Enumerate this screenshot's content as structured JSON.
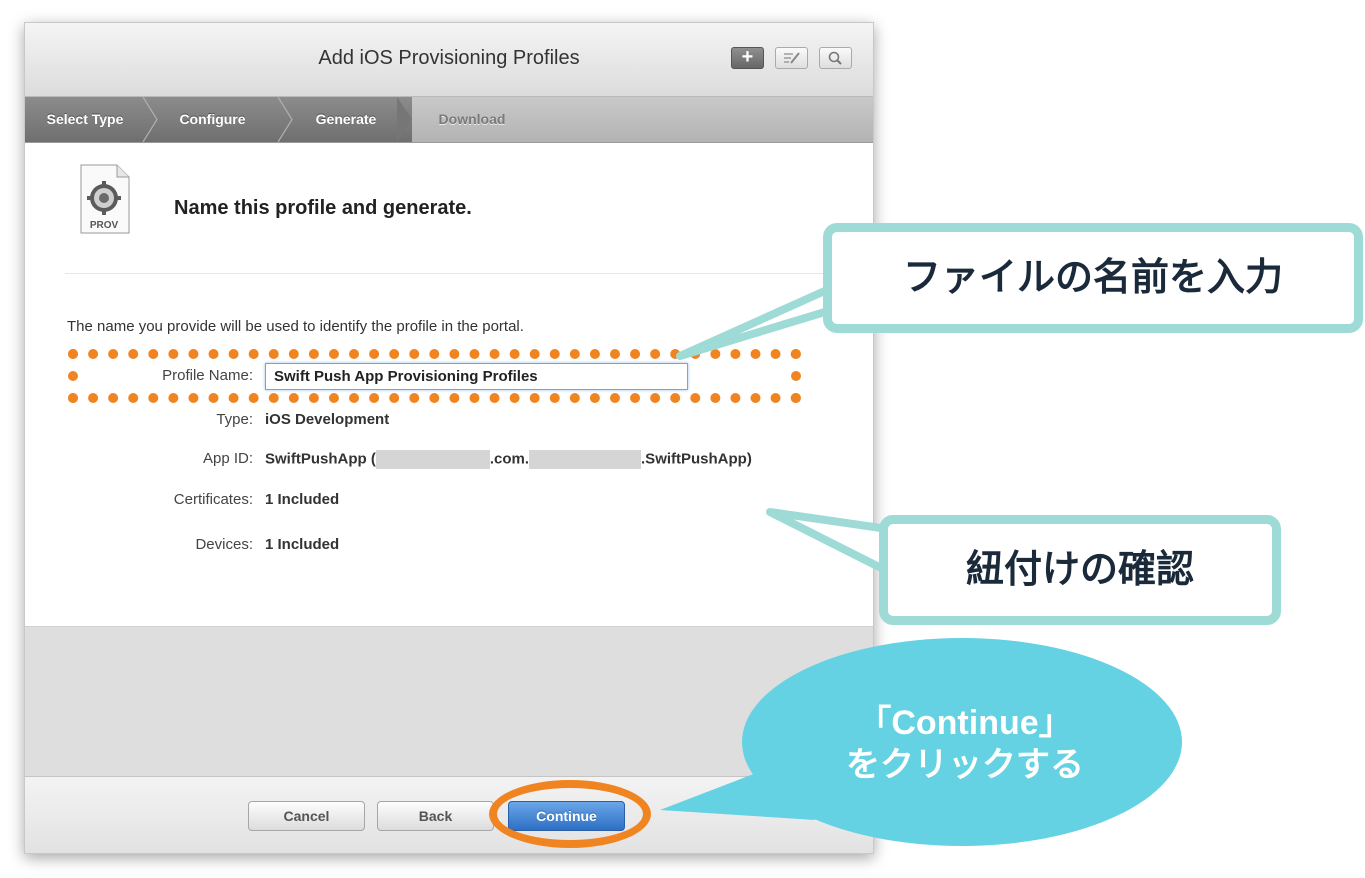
{
  "window": {
    "title": "Add iOS Provisioning Profiles",
    "add_button": "+"
  },
  "steps": [
    {
      "label": "Select Type",
      "state": "done"
    },
    {
      "label": "Configure",
      "state": "done"
    },
    {
      "label": "Generate",
      "state": "done"
    },
    {
      "label": "Download",
      "state": "todo"
    }
  ],
  "icon": {
    "name": "prov-file-icon",
    "label": "PROV"
  },
  "content": {
    "heading": "Name this profile and generate.",
    "intro": "The name you provide will be used to identify the profile in the portal.",
    "profile_name_label": "Profile Name:",
    "profile_name_value": "Swift Push App Provisioning Profiles",
    "type_label": "Type:",
    "type_value": "iOS Development",
    "app_id_label": "App ID:",
    "app_id_prefix": "SwiftPushApp (",
    "app_id_middle": ".com.",
    "app_id_suffix": ".SwiftPushApp)",
    "certificates_label": "Certificates:",
    "certificates_value": "1 Included",
    "devices_label": "Devices:",
    "devices_value": "1 Included"
  },
  "buttons": {
    "cancel": "Cancel",
    "back": "Back",
    "continue": "Continue"
  },
  "annotations": {
    "callout_name": "ファイルの名前を入力",
    "callout_confirm": "紐付けの確認",
    "bubble_line1": "「Continue」",
    "bubble_line2": "をクリックする"
  },
  "colors": {
    "accent_orange": "#f08420",
    "callout_border": "#9fdbd6",
    "bubble": "#64d2e3",
    "primary_button": "#2d6fc4"
  }
}
